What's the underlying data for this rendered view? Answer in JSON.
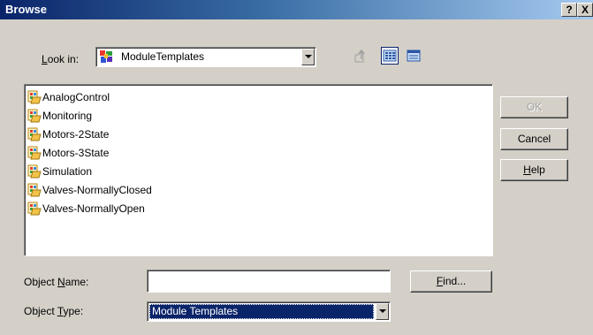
{
  "window": {
    "title": "Browse",
    "help_glyph": "?",
    "close_glyph": "X"
  },
  "lookin": {
    "label_prefix": "",
    "label_accel": "L",
    "label_rest": "ook in:",
    "value": "ModuleTemplates"
  },
  "list": {
    "items": [
      "AnalogControl",
      "Monitoring",
      "Motors-2State",
      "Motors-3State",
      "Simulation",
      "Valves-NormallyClosed",
      "Valves-NormallyOpen"
    ]
  },
  "buttons": {
    "ok": "OK",
    "cancel": "Cancel",
    "help_accel": "H",
    "help_rest": "elp",
    "find_accel": "F",
    "find_rest": "ind..."
  },
  "object_name": {
    "label_pre": "Object ",
    "label_accel": "N",
    "label_rest": "ame:",
    "value": ""
  },
  "object_type": {
    "label_pre": "Object ",
    "label_accel": "T",
    "label_rest": "ype:",
    "value": "Module Templates"
  },
  "colors": {
    "title_start": "#0a246a",
    "title_end": "#a6caf0",
    "face": "#d4d0c8",
    "selection": "#0a246a"
  },
  "icons": [
    "folder-template-icon",
    "up-folder-icon",
    "list-view-icon",
    "details-view-icon",
    "module-templates-icon"
  ]
}
